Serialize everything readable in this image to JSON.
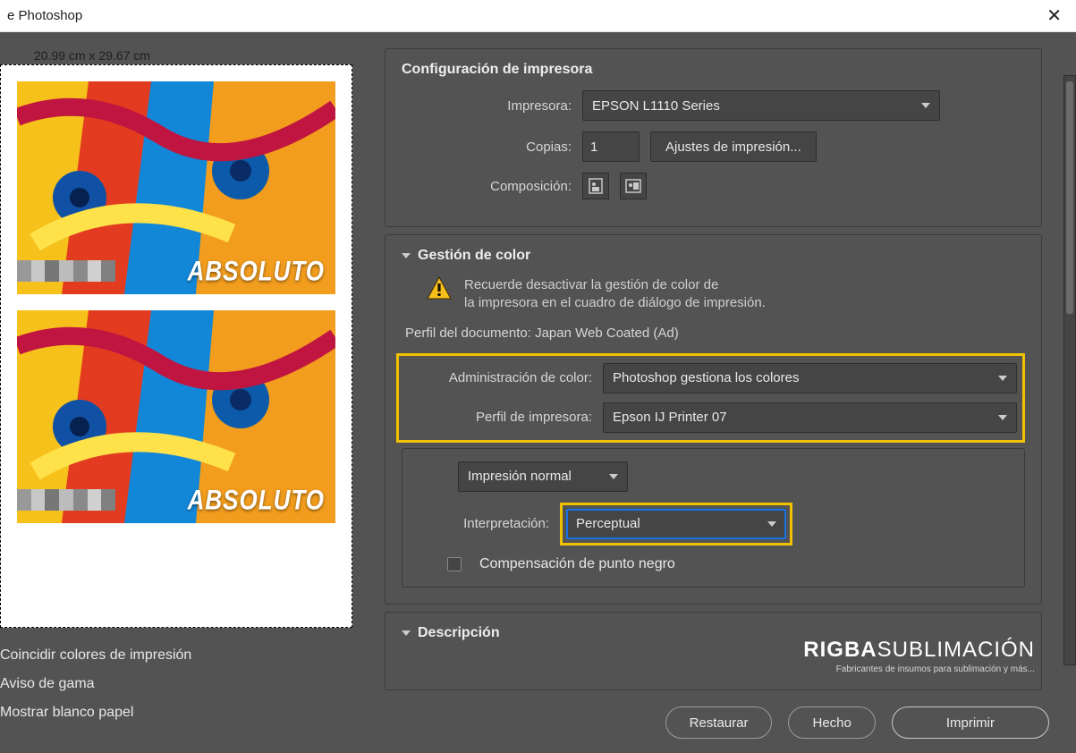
{
  "titlebar": {
    "title": "e Photoshop"
  },
  "preview": {
    "dimensions": "20.99 cm x 29.67 cm",
    "art_overlay_text": "ABSOLUTO"
  },
  "left_checks": {
    "match_colors": "Coincidir colores de impresión",
    "gamut_warning": "Aviso de gama",
    "show_paper_white": "Mostrar blanco papel"
  },
  "printer_setup": {
    "section_title": "Configuración de impresora",
    "printer_label": "Impresora:",
    "printer_value": "EPSON L1110 Series",
    "copies_label": "Copias:",
    "copies_value": "1",
    "print_settings_btn": "Ajustes de impresión...",
    "layout_label": "Composición:"
  },
  "color_mgmt": {
    "section_title": "Gestión de color",
    "warning_line1": "Recuerde desactivar la gestión de color de",
    "warning_line2": "la impresora en el cuadro de diálogo de impresión.",
    "doc_profile_label": "Perfil del documento:",
    "doc_profile_value": "Japan Web Coated (Ad)",
    "color_handling_label": "Administración de color:",
    "color_handling_value": "Photoshop gestiona los colores",
    "printer_profile_label": "Perfil de impresora:",
    "printer_profile_value": "Epson IJ Printer 07",
    "print_mode_value": "Impresión normal",
    "rendering_intent_label": "Interpretación:",
    "rendering_intent_value": "Perceptual",
    "black_point_label": "Compensación de punto negro"
  },
  "description": {
    "section_title": "Descripción"
  },
  "buttons": {
    "restore": "Restaurar",
    "done": "Hecho",
    "print": "Imprimir"
  },
  "watermark": {
    "brand_bold": "RIGBA",
    "brand_light": "SUBLIMACIÓN",
    "tagline": "Fabricantes de insumos para sublimación y más..."
  }
}
